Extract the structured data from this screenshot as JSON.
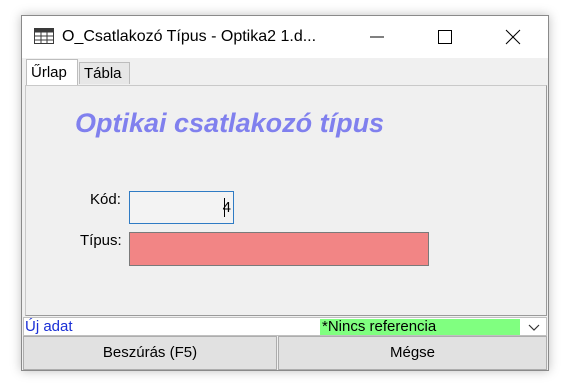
{
  "window": {
    "title": "O_Csatlakozó Típus - Optika2 1.d..."
  },
  "tabs": [
    {
      "label": "Űrlap",
      "active": true
    },
    {
      "label": "Tábla",
      "active": false
    }
  ],
  "form": {
    "title": "Optikai csatlakozó típus",
    "fields": {
      "kod_label": "Kód:",
      "kod_value": "4",
      "tipus_label": "Típus:",
      "tipus_value": ""
    }
  },
  "status": {
    "new_record": "Új adat",
    "reference": "*Nincs referencia"
  },
  "buttons": {
    "insert": "Beszúrás (F5)",
    "cancel": "Mégse"
  },
  "colors": {
    "form_title": "#8080ee",
    "tipus_field": "#f28585",
    "reference_bg": "#80ff80",
    "new_record_text": "#1a2fd6"
  },
  "icons": {
    "app": "table-icon",
    "minimize": "minimize-icon",
    "maximize": "maximize-icon",
    "close": "close-icon",
    "dropdown": "chevron-down-icon"
  }
}
